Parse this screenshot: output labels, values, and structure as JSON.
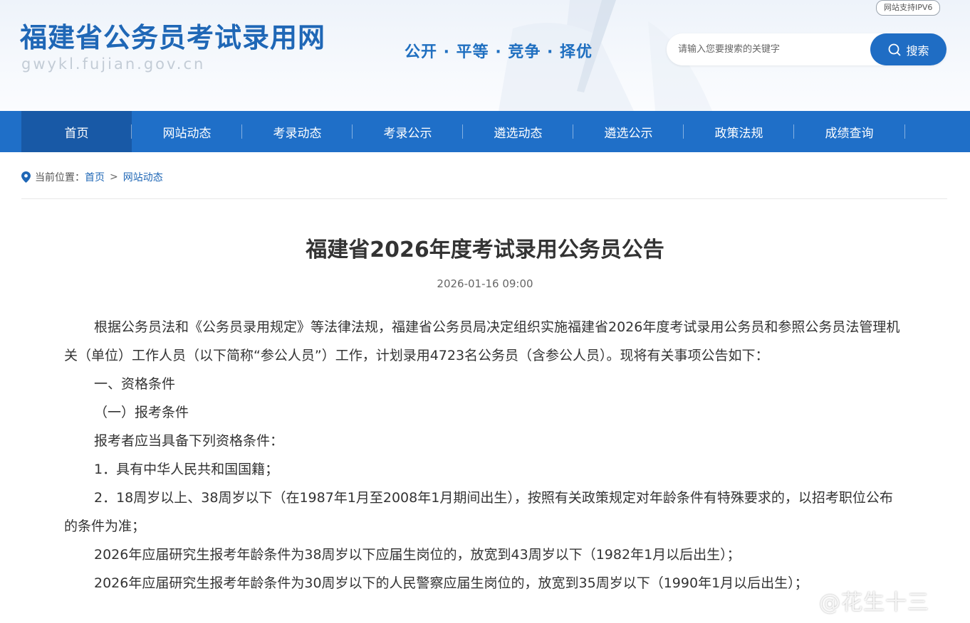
{
  "header": {
    "site_title": "福建省公务员考试录用网",
    "site_url": "gwykl.fujian.gov.cn",
    "slogan": "公开 · 平等 · 竞争 · 择优",
    "ipv6_badge": "网站支持IPV6",
    "search": {
      "placeholder": "请输入您要搜索的关键字",
      "button_label": "搜索"
    }
  },
  "nav": {
    "items": [
      "首页",
      "网站动态",
      "考录动态",
      "考录公示",
      "遴选动态",
      "遴选公示",
      "政策法规",
      "成绩查询"
    ],
    "active_index": 0
  },
  "breadcrumb": {
    "label": "当前位置：",
    "home": "首页",
    "separator": ">",
    "current": "网站动态"
  },
  "article": {
    "title": "福建省2026年度考试录用公务员公告",
    "date": "2026-01-16 09:00",
    "paragraphs": [
      "根据公务员法和《公务员录用规定》等法律法规，福建省公务员局决定组织实施福建省2026年度考试录用公务员和参照公务员法管理机关（单位）工作人员（以下简称“参公人员”）工作，计划录用4723名公务员（含参公人员）。现将有关事项公告如下：",
      "一、资格条件",
      "（一）报考条件",
      "报考者应当具备下列资格条件：",
      "1．具有中华人民共和国国籍；",
      "2．18周岁以上、38周岁以下（在1987年1月至2008年1月期间出生），按照有关政策规定对年龄条件有特殊要求的，以招考职位公布的条件为准；",
      "2026年应届研究生报考年龄条件为38周岁以下应届生岗位的，放宽到43周岁以下（1982年1月以后出生）；",
      "2026年应届研究生报考年龄条件为30周岁以下的人民警察应届生岗位的，放宽到35周岁以下（1990年1月以后出生）；"
    ]
  },
  "watermark": "@花生十三",
  "colors": {
    "brand": "#1f6fc8",
    "nav_active": "#1859a6",
    "title_blue": "#1f67b6"
  }
}
